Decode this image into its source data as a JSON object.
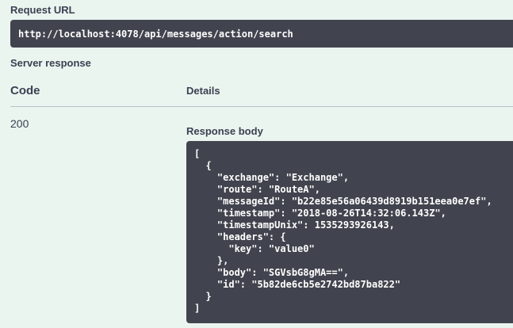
{
  "request_url": {
    "heading": "Request URL",
    "value": "http://localhost:4078/api/messages/action/search"
  },
  "server_response": {
    "heading": "Server response",
    "columns": {
      "code": "Code",
      "details": "Details"
    },
    "status_code": "200",
    "response_body": {
      "heading": "Response body",
      "content": "[\n  {\n    \"exchange\": \"Exchange\",\n    \"route\": \"RouteA\",\n    \"messageId\": \"b22e85e56a06439d8919b151eea0e7ef\",\n    \"timestamp\": \"2018-08-26T14:32:06.143Z\",\n    \"timestampUnix\": 1535293926143,\n    \"headers\": {\n      \"key\": \"value0\"\n    },\n    \"body\": \"SGVsbG8gMA==\",\n    \"id\": \"5b82de6cb5e2742bd87ba822\"\n  }\n]"
    }
  },
  "colors": {
    "background": "#eaf5f0",
    "code_box": "#41444e",
    "text": "#3b4151",
    "divider": "#b8c1c7"
  }
}
